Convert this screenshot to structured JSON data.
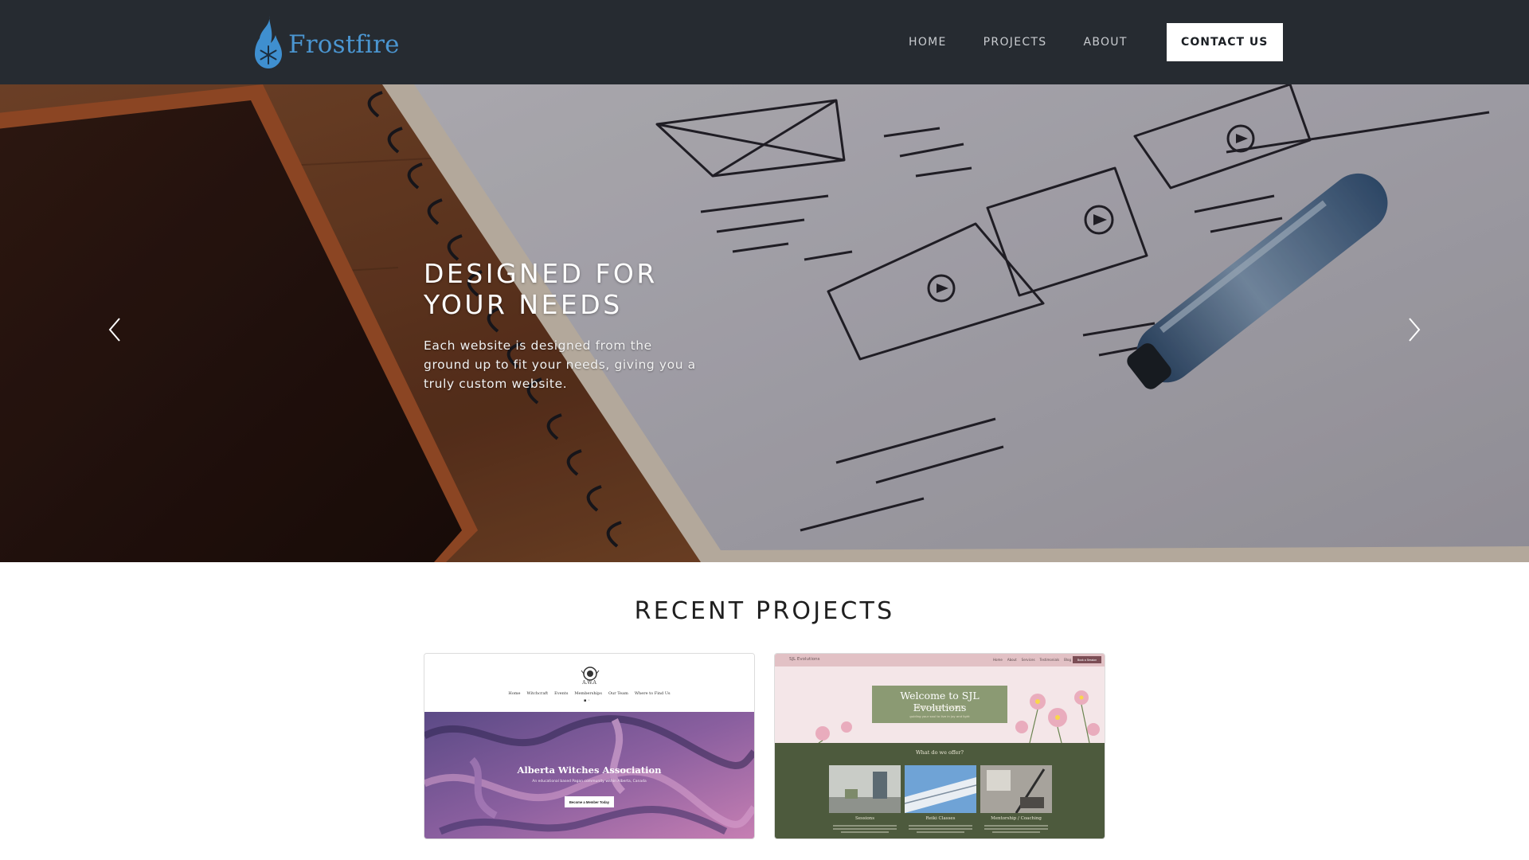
{
  "brand": {
    "name": "Frostfire",
    "logo_icon": "flame-snowflake-icon",
    "color": "#4b96d1"
  },
  "nav": {
    "items": [
      "HOME",
      "PROJECTS",
      "ABOUT"
    ],
    "contact_label": "CONTACT US"
  },
  "hero": {
    "title_line1": "DESIGNED FOR",
    "title_line2": "YOUR NEEDS",
    "text": "Each website is designed from the ground up to fit your needs, giving you a truly custom website.",
    "prev_icon": "chevron-left-icon",
    "next_icon": "chevron-right-icon"
  },
  "projects": {
    "heading": "RECENT PROJECTS",
    "awa": {
      "abbr": "A.W.A",
      "nav": [
        "Home",
        "Witchcraft",
        "Events",
        "Memberships",
        "Our Team",
        "Where to Find Us"
      ],
      "title": "Alberta Witches Association",
      "subtitle": "An educational based Pagan community within Alberta, Canada",
      "button": "Become a Member Today"
    },
    "sjl": {
      "logo": "SJL Evolutions",
      "nav": [
        "Home",
        "About",
        "Services",
        "Testimonials",
        "Blog"
      ],
      "nav_button": "Book a Session",
      "welcome": "Welcome to SJL Evolutions",
      "tagline": "SOUL • JOY • LIGHT",
      "subtagline": "guiding your soul to live in joy and light",
      "offer": "What do we offer?",
      "tiles": [
        "Sessions",
        "Reiki Classes",
        "Mentorship / Coaching"
      ]
    }
  },
  "colors": {
    "header_bg": "#262b31",
    "accent": "#4b96d1"
  }
}
